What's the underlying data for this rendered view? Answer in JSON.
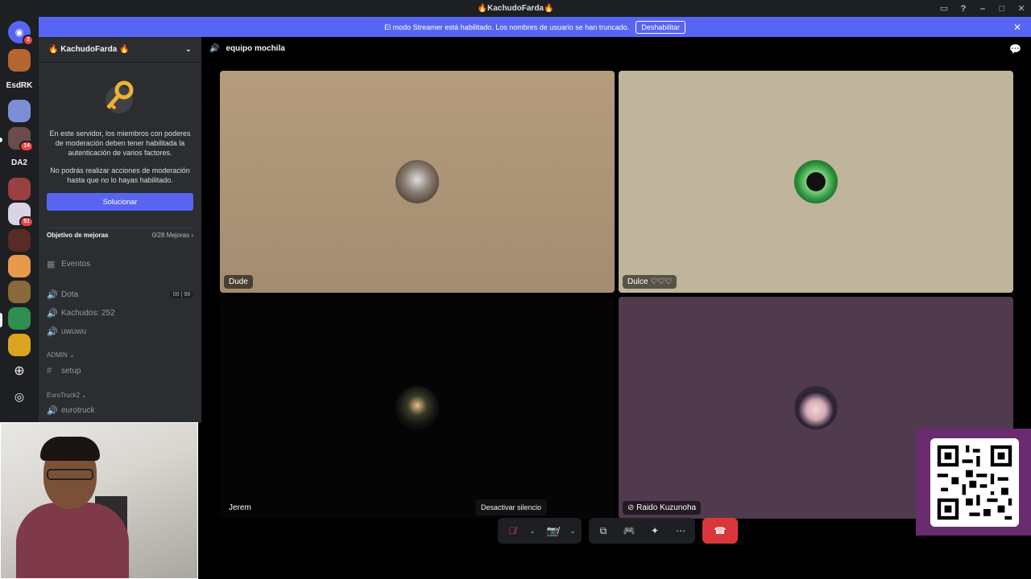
{
  "titlebar": {
    "title": "🔥KachudoFarda🔥",
    "icons": [
      "screen-share-icon",
      "help-icon",
      "minimize-icon",
      "maximize-icon",
      "close-icon"
    ]
  },
  "rail": {
    "labels": [
      {
        "text": "EsdRK"
      },
      {
        "text": "DA2"
      }
    ],
    "badges": [
      "2",
      "14",
      "6",
      "51"
    ]
  },
  "streamer": {
    "message": "El modo Streamer está habilitado. Los nombres de usuario se han truncado.",
    "button": "Deshabilitar"
  },
  "server": {
    "name": "🔥 KachudoFarda 🔥"
  },
  "mfa": {
    "text1": "En este servidor, los miembros con poderes de moderación deben tener habilitada la autenticación de varios factores.",
    "text2": "No podrás realizar acciones de moderación hasta que no lo hayas habilitado.",
    "button": "Solucionar"
  },
  "boost": {
    "label": "Objetivo de mejoras",
    "value": "0/28 Mejoras"
  },
  "channels": {
    "events": "Eventos",
    "dota": "Dota",
    "dota_tag1": "00",
    "dota_tag2": "99",
    "kachudos": "Kachudos: 252",
    "uwuwu": "uwuwu",
    "cat_admin": "ADMIN",
    "setup": "setup",
    "cat_euro": "EuroTruck2",
    "eurotruck": "eurotruck"
  },
  "voice": {
    "channel": "equipo mochila"
  },
  "tiles": [
    {
      "name": "Dude"
    },
    {
      "name": "Dulce ♡♡♡"
    },
    {
      "name": "Jerem"
    },
    {
      "name": "Raido Kuzunoha"
    }
  ],
  "tooltip": "Desactivar silencio",
  "colors": {
    "accent": "#5865f2",
    "danger": "#da373c",
    "sidebar": "#2b2d31",
    "rail": "#1e1f22"
  }
}
